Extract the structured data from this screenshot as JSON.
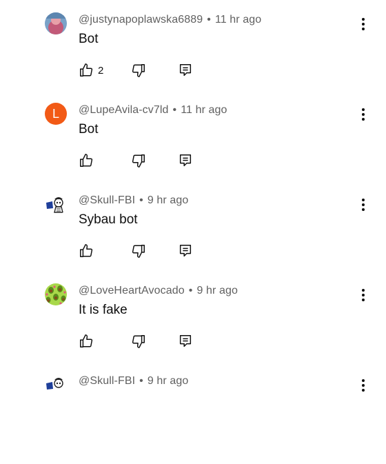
{
  "comments": [
    {
      "handle": "@justynapoplawska6889",
      "time": "11 hr ago",
      "text": "Bot",
      "likes": "2",
      "avatar_letter": "",
      "avatar_color": "#6a8fb5"
    },
    {
      "handle": "@LupeAvila-cv7ld",
      "time": "11 hr ago",
      "text": "Bot",
      "likes": "",
      "avatar_letter": "L",
      "avatar_color": "#f25a16"
    },
    {
      "handle": "@Skull-FBI",
      "time": "9 hr ago",
      "text": "Sybau bot",
      "likes": "",
      "avatar_letter": "",
      "avatar_color": "#ffffff"
    },
    {
      "handle": "@LoveHeartAvocado",
      "time": "9 hr ago",
      "text": "It is fake",
      "likes": "",
      "avatar_letter": "",
      "avatar_color": "#9acd32"
    },
    {
      "handle": "@Skull-FBI",
      "time": "9 hr ago",
      "text": "",
      "likes": "",
      "avatar_letter": "",
      "avatar_color": "#ffffff"
    }
  ],
  "separator": "•",
  "icons": {
    "like": "thumb-up-icon",
    "dislike": "thumb-down-icon",
    "reply": "reply-icon",
    "more": "more-vertical-icon"
  }
}
